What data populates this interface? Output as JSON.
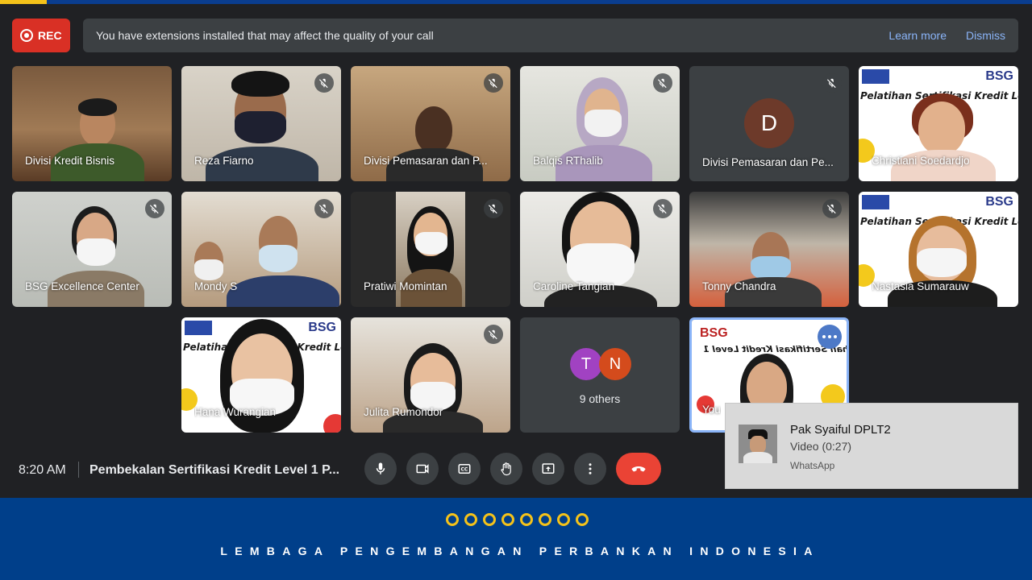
{
  "recording": {
    "label": "REC"
  },
  "banner": {
    "message": "You have extensions installed that may affect the quality of your call",
    "learn_more": "Learn more",
    "dismiss": "Dismiss"
  },
  "participants": [
    {
      "name": "Divisi Kredit Bisnis"
    },
    {
      "name": "Reza Fiarno"
    },
    {
      "name": "Divisi Pemasaran dan P..."
    },
    {
      "name": "Balqis RThalib"
    },
    {
      "name": "Divisi Pemasaran dan Pe...",
      "avatar_letter": "D"
    },
    {
      "name": "Christiani Soedardjo"
    },
    {
      "name": "BSG Excellence Center"
    },
    {
      "name": "Mondy S"
    },
    {
      "name": "Pratiwi Momintan"
    },
    {
      "name": "Caroline Tangian"
    },
    {
      "name": "Tonny Chandra"
    },
    {
      "name": "Nastasia Sumarauw"
    },
    {
      "name": "Hana Wurangian"
    },
    {
      "name": "Julita Rumondor"
    },
    {
      "name": "You"
    }
  ],
  "slide": {
    "title": "Pelatihan Sertifikasi Kredit Level 1",
    "bsg": "BSG"
  },
  "others": {
    "count_label": "9 others",
    "avatars": [
      "T",
      "N"
    ],
    "colors": [
      "#a142c2",
      "#d44b1c"
    ]
  },
  "bottom_bar": {
    "time": "8:20 AM",
    "meeting_title": "Pembekalan Sertifikasi Kredit Level 1 P...",
    "controls": [
      "mic-icon",
      "camera-icon",
      "captions-icon",
      "raise-hand-icon",
      "present-icon",
      "more-icon",
      "end-call-icon"
    ]
  },
  "notification": {
    "sender": "Pak Syaiful DPLT2",
    "message": "Video (0:27)",
    "app": "WhatsApp"
  },
  "footer": {
    "org": "LEMBAGA PENGEMBANGAN PERBANKAN INDONESIA"
  },
  "colors": {
    "rec": "#d93025",
    "end_call": "#ea4335",
    "link": "#8ab4f8",
    "footer_bg": "#003f8a",
    "footer_ring": "#f4c21a"
  }
}
